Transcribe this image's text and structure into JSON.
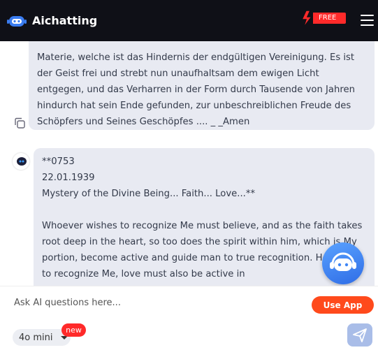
{
  "header": {
    "brand": "Aichatting",
    "free_label": "FREE"
  },
  "messages": [
    {
      "role": "bot",
      "paragraphs": [
        "Materie, welche ist das Hindernis der endgültigen Vereinigung. Es ist der Geist frei und strebt nun unaufhaltsam dem ewigen Licht entgegen, und das Verharren in der Form durch Tausende von Jahren hindurch hat sein Ende gefunden, zur unbeschreiblichen Freude des Schöpfers und Seines Geschöpfes .... _ _Amen"
      ]
    },
    {
      "role": "bot",
      "paragraphs": [
        "**0753\n22.01.1939\nMystery of the Divine Being... Faith... Love...**",
        "Whoever wishes to recognize Me must believe, and as the faith takes root deep in the heart, so too does the spirit within him, which is My portion, become active and guide man to true recognition. However, to recognize Me, love must also be active in"
      ]
    }
  ],
  "input": {
    "placeholder": "Ask AI questions here...",
    "use_app_label": "Use App",
    "model_label": "4o mini",
    "new_badge": "new"
  },
  "colors": {
    "header_bg": "#0f1017",
    "bubble_bg": "#e8eaf2",
    "accent_orange": "#ff4a1c",
    "badge_red": "#ff2a2a",
    "fab_blue": "#3f86f5"
  }
}
